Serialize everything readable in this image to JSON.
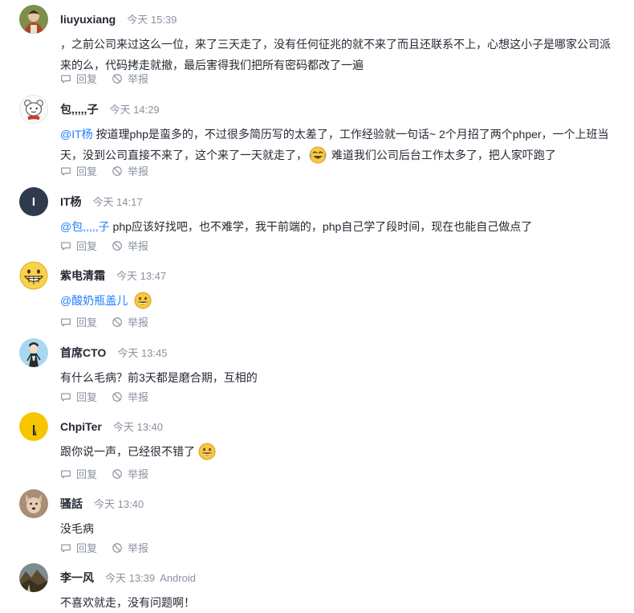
{
  "comments": [
    {
      "name": "liuyuxiang",
      "time": "今天 15:39",
      "avatar": "photo-avatar-icon",
      "lines": [
        "，之前公司来过这么一位，来了三天走了，没有任何征兆的就不来了而且还联系不上，心想这小子是哪家公司派",
        "来的么，代码拷走就撤，最后害得我们把所有密码都改了一遍"
      ]
    },
    {
      "name": "包,,,,,子",
      "time": "今天 14:29",
      "avatar": "panda-avatar-icon",
      "mention": "@IT杨",
      "line1_rest": " 按道理php是蛮多的，不过很多简历写的太差了，工作经验就一句话~ 2个月招了两个phper，一个上班当",
      "line2_before_emoji": "天，没到公司直接不来了，这个来了一天就走了，",
      "line2_after_emoji": " 难道我们公司后台工作太多了，把人家吓跑了"
    },
    {
      "name": "IT杨",
      "time": "今天 14:17",
      "avatar_letter": "I",
      "mention": "@包,,,,,子",
      "text": " php应该好找吧，也不难学，我干前端的，php自己学了段时间，现在也能自己做点了"
    },
    {
      "name": "紫电清霜",
      "time": "今天 13:47",
      "avatar": "grin-emoji-avatar-icon",
      "mention": "@酸奶瓶盖儿"
    },
    {
      "name": "首席CTO",
      "time": "今天 13:45",
      "avatar": "cartoon-avatar-icon",
      "text": "有什么毛病？前3天都是磨合期，互相的"
    },
    {
      "name": "ChpiTer",
      "time": "今天 13:40",
      "avatar": "yellow-avatar-icon",
      "text": "跟你说一声，已经很不错了"
    },
    {
      "name": "骚話",
      "time": "今天 13:40",
      "avatar": "dog-photo-avatar-icon",
      "text": "没毛病"
    },
    {
      "name": "李一风",
      "time": "今天 13:39",
      "device": "Android",
      "avatar": "landscape-avatar-icon",
      "text": "不喜欢就走，没有问题啊！"
    }
  ],
  "actions": {
    "reply": "回复",
    "report": "举报"
  },
  "colors": {
    "mention": "#1e80ff",
    "meta": "#8a919f",
    "text": "#252933"
  }
}
